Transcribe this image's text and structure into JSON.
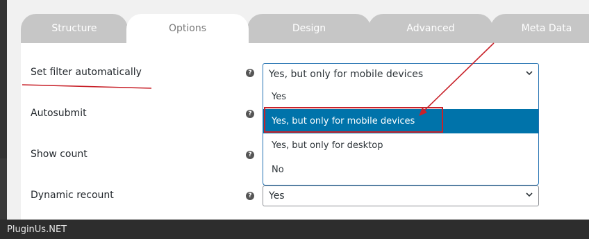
{
  "tabs": [
    {
      "label": "Structure",
      "active": false
    },
    {
      "label": "Options",
      "active": true
    },
    {
      "label": "Design",
      "active": false
    },
    {
      "label": "Advanced",
      "active": false
    },
    {
      "label": "Meta Data",
      "active": false
    }
  ],
  "rows": {
    "set_filter": {
      "label": "Set filter automatically",
      "value": "Yes, but only for mobile devices"
    },
    "autosubmit": {
      "label": "Autosubmit"
    },
    "show_count": {
      "label": "Show count"
    },
    "dynamic_recount": {
      "label": "Dynamic recount",
      "value": "Yes"
    }
  },
  "dropdown_options": [
    "Yes",
    "Yes, but only for mobile devices",
    "Yes, but only for desktop",
    "No"
  ],
  "help_glyph": "?",
  "footer": {
    "watermark": "PluginUs.NET"
  },
  "colors": {
    "accent": "#0073aa",
    "annotation": "#c8222a",
    "tab_inactive": "#c6c6c6"
  },
  "icons": [
    "help-icon",
    "chevron-down-icon"
  ]
}
